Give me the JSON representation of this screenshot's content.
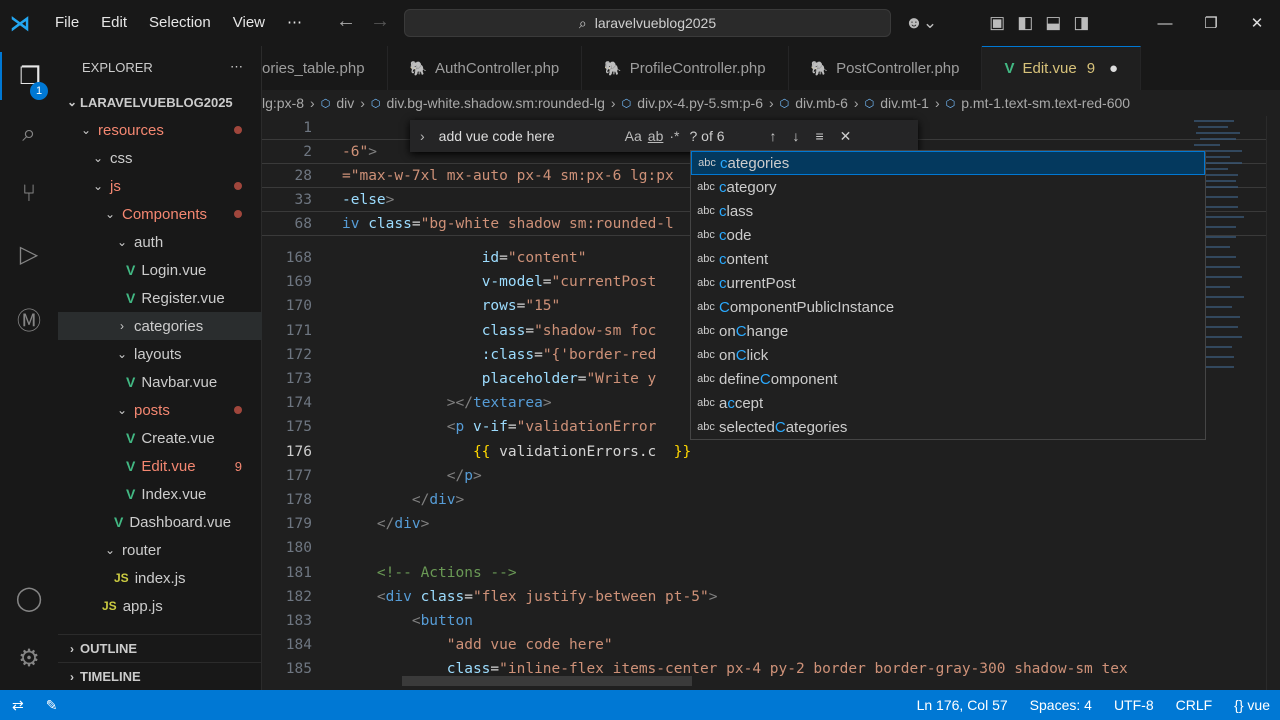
{
  "menu": [
    "File",
    "Edit",
    "Selection",
    "View",
    "⋯"
  ],
  "search": {
    "text": "laravelvueblog2025"
  },
  "sidebar": {
    "title": "EXPLORER",
    "root": "LARAVELVUEBLOG2025",
    "items": [
      {
        "label": "resources",
        "indent": 1,
        "type": "folder",
        "open": true,
        "red": true,
        "dot": true
      },
      {
        "label": "css",
        "indent": 2,
        "type": "folder",
        "open": true
      },
      {
        "label": "js",
        "indent": 2,
        "type": "folder",
        "open": true,
        "red": true,
        "dot": true
      },
      {
        "label": "Components",
        "indent": 3,
        "type": "folder",
        "open": true,
        "red": true,
        "dot": true
      },
      {
        "label": "auth",
        "indent": 4,
        "type": "folder",
        "open": true
      },
      {
        "label": "Login.vue",
        "indent": 5,
        "type": "vue"
      },
      {
        "label": "Register.vue",
        "indent": 5,
        "type": "vue"
      },
      {
        "label": "categories",
        "indent": 4,
        "type": "folder",
        "open": false,
        "sel": true
      },
      {
        "label": "layouts",
        "indent": 4,
        "type": "folder",
        "open": true
      },
      {
        "label": "Navbar.vue",
        "indent": 5,
        "type": "vue"
      },
      {
        "label": "posts",
        "indent": 4,
        "type": "folder",
        "open": true,
        "red": true,
        "dot": true
      },
      {
        "label": "Create.vue",
        "indent": 5,
        "type": "vue"
      },
      {
        "label": "Edit.vue",
        "indent": 5,
        "type": "vue",
        "red": true,
        "count": "9"
      },
      {
        "label": "Index.vue",
        "indent": 5,
        "type": "vue"
      },
      {
        "label": "Dashboard.vue",
        "indent": 4,
        "type": "vue"
      },
      {
        "label": "router",
        "indent": 3,
        "type": "folder",
        "open": true
      },
      {
        "label": "index.js",
        "indent": 4,
        "type": "js"
      },
      {
        "label": "app.js",
        "indent": 3,
        "type": "js"
      }
    ],
    "outline": "OUTLINE",
    "timeline": "TIMELINE"
  },
  "tabs": [
    {
      "label": "ories_table.php",
      "type": "none"
    },
    {
      "label": "AuthController.php",
      "type": "php"
    },
    {
      "label": "ProfileController.php",
      "type": "php"
    },
    {
      "label": "PostController.php",
      "type": "php"
    },
    {
      "label": "Edit.vue",
      "type": "vue",
      "active": true,
      "count": "9"
    }
  ],
  "breadcrumb": [
    "lg:px-8",
    "div",
    "div.bg-white.shadow.sm:rounded-lg",
    "div.px-4.py-5.sm:p-6",
    "div.mb-6",
    "div.mt-1",
    "p.mt-1.text-sm.text-red-600"
  ],
  "sticky": [
    {
      "n": "1",
      "html": ""
    },
    {
      "n": "2",
      "html": "<span class='st'>-6\"</span><span class='tg'>&gt;</span>"
    },
    {
      "n": "28",
      "html": "<span class='st'>=\"max-w-7xl mx-auto px-4 sm:px-6 lg:px</span>"
    },
    {
      "n": "33",
      "html": "<span class='at'>-else</span><span class='tg'>&gt;</span>"
    },
    {
      "n": "68",
      "html": "<span class='tn'>iv</span> <span class='at'>class</span><span class='pl'>=</span><span class='st'>\"bg-white shadow sm:rounded-l</span>"
    }
  ],
  "lines": [
    {
      "n": "168",
      "html": "                <span class='at'>id</span><span class='pl'>=</span><span class='st'>\"content\"</span>"
    },
    {
      "n": "169",
      "html": "                <span class='at'>v-model</span><span class='pl'>=</span><span class='st'>\"currentPost</span>"
    },
    {
      "n": "170",
      "html": "                <span class='at'>rows</span><span class='pl'>=</span><span class='st'>\"15\"</span>"
    },
    {
      "n": "171",
      "html": "                <span class='at'>class</span><span class='pl'>=</span><span class='st'>\"shadow-sm foc</span>"
    },
    {
      "n": "172",
      "html": "                <span class='at'>:class</span><span class='pl'>=</span><span class='st'>\"{'border-red</span>"
    },
    {
      "n": "173",
      "html": "                <span class='at'>placeholder</span><span class='pl'>=</span><span class='st'>\"Write y</span>"
    },
    {
      "n": "174",
      "html": "            <span class='tg'>&gt;&lt;/</span><span class='tn'>textarea</span><span class='tg'>&gt;</span>"
    },
    {
      "n": "175",
      "html": "            <span class='tg'>&lt;</span><span class='tn'>p</span> <span class='at'>v-if</span><span class='pl'>=</span><span class='st'>\"validationError</span>"
    },
    {
      "n": "176",
      "html": "               <span class='mu'>{{</span> <span class='pl'>validationErrors.c</span>  <span class='mu'>}}</span>",
      "cur": true
    },
    {
      "n": "177",
      "html": "            <span class='tg'>&lt;/</span><span class='tn'>p</span><span class='tg'>&gt;</span>"
    },
    {
      "n": "178",
      "html": "        <span class='tg'>&lt;/</span><span class='tn'>div</span><span class='tg'>&gt;</span>"
    },
    {
      "n": "179",
      "html": "    <span class='tg'>&lt;/</span><span class='tn'>div</span><span class='tg'>&gt;</span>"
    },
    {
      "n": "180",
      "html": ""
    },
    {
      "n": "181",
      "html": "    <span class='cm'>&lt;!-- Actions --&gt;</span>"
    },
    {
      "n": "182",
      "html": "    <span class='tg'>&lt;</span><span class='tn'>div</span> <span class='at'>class</span><span class='pl'>=</span><span class='st'>\"flex justify-between pt-5\"</span><span class='tg'>&gt;</span>"
    },
    {
      "n": "183",
      "html": "        <span class='tg'>&lt;</span><span class='tn'>button</span>"
    },
    {
      "n": "184",
      "html": "            <span class='st'>\"add vue code here\"</span>"
    },
    {
      "n": "185",
      "html": "            <span class='at'>class</span><span class='pl'>=</span><span class='st'>\"inline-flex items-center px-4 py-2 border border-gray-300 shadow-sm tex</span>"
    }
  ],
  "find": {
    "query": "add vue code here",
    "opts": [
      "Aa",
      "ab",
      "·*"
    ],
    "count": "? of 6"
  },
  "suggestions": [
    {
      "pre": "",
      "m": "c",
      "post": "ategories",
      "sel": true
    },
    {
      "pre": "",
      "m": "c",
      "post": "ategory"
    },
    {
      "pre": "",
      "m": "c",
      "post": "lass"
    },
    {
      "pre": "",
      "m": "c",
      "post": "ode"
    },
    {
      "pre": "",
      "m": "c",
      "post": "ontent"
    },
    {
      "pre": "",
      "m": "c",
      "post": "urrentPost"
    },
    {
      "pre": "",
      "m": "C",
      "post": "omponentPublicInstance"
    },
    {
      "pre": "on",
      "m": "C",
      "post": "hange"
    },
    {
      "pre": "on",
      "m": "C",
      "post": "lick"
    },
    {
      "pre": "define",
      "m": "C",
      "post": "omponent"
    },
    {
      "pre": "a",
      "m": "c",
      "post": "cept"
    },
    {
      "pre": "selected",
      "m": "C",
      "post": "ategories"
    }
  ],
  "status": {
    "position": "Ln 176, Col 57",
    "spaces": "Spaces: 4",
    "encoding": "UTF-8",
    "eol": "CRLF",
    "lang": "vue"
  }
}
